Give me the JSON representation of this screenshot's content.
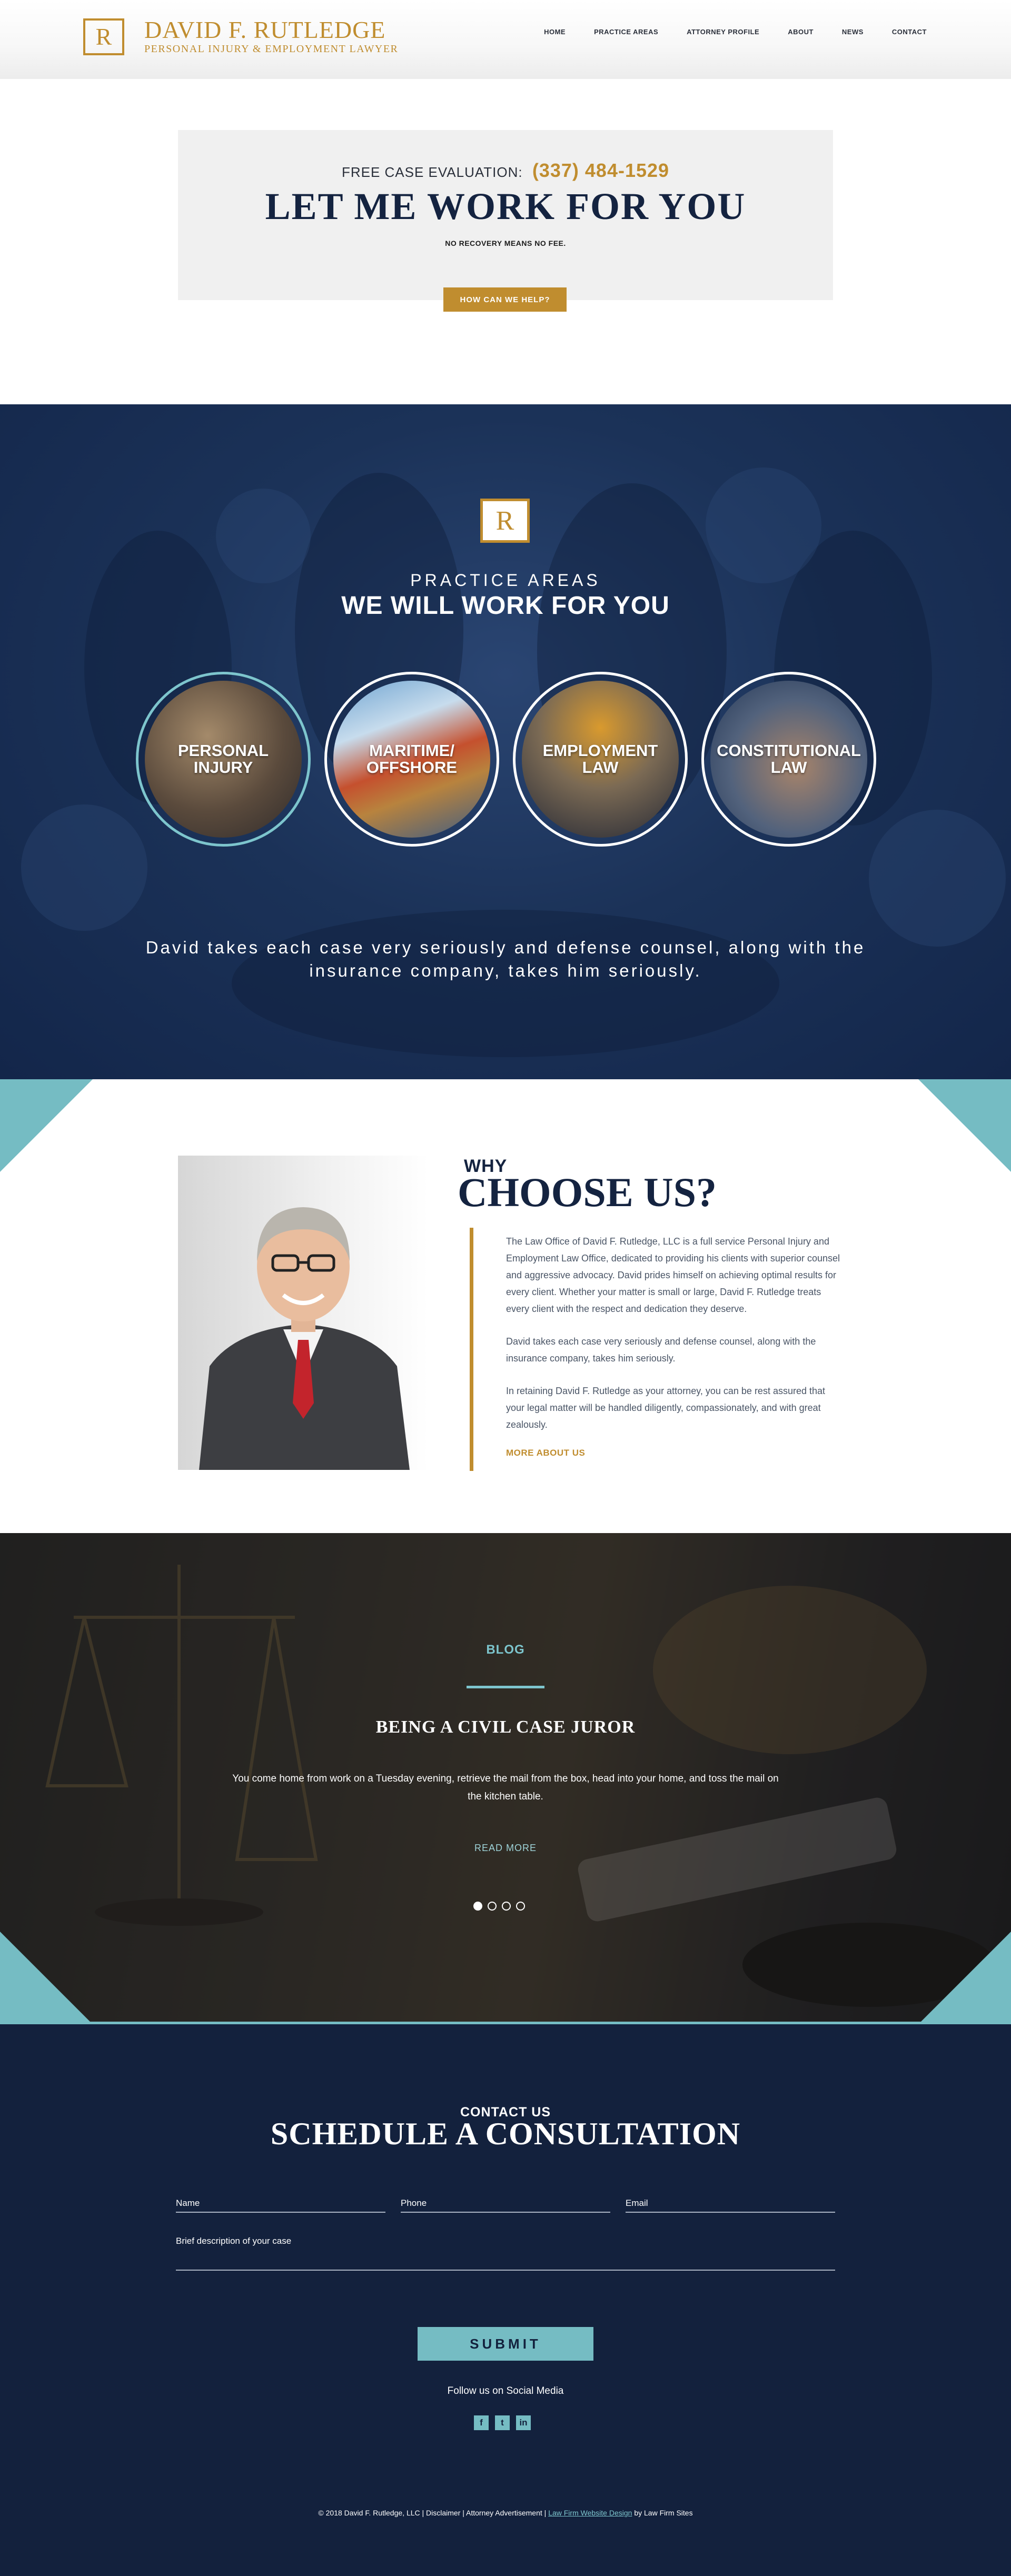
{
  "header": {
    "logo_letter": "R",
    "name": "DAVID F. RUTLEDGE",
    "tagline": "PERSONAL INJURY & EMPLOYMENT LAWYER",
    "nav": [
      "HOME",
      "PRACTICE AREAS",
      "ATTORNEY PROFILE",
      "ABOUT",
      "NEWS",
      "CONTACT"
    ]
  },
  "hero": {
    "eval_label": "FREE CASE EVALUATION:",
    "phone": "(337) 484-1529",
    "title": "LET ME WORK FOR YOU",
    "subtitle": "NO RECOVERY MEANS NO FEE.",
    "cta": "HOW CAN WE HELP?"
  },
  "practice": {
    "logo_letter": "R",
    "kicker": "PRACTICE AREAS",
    "title": "WE WILL WORK FOR YOU",
    "areas": [
      {
        "label": "PERSONAL INJURY",
        "active": true
      },
      {
        "label": "MARITIME/ OFFSHORE",
        "active": false
      },
      {
        "label": "EMPLOYMENT LAW",
        "active": false
      },
      {
        "label": "CONSTITUTIONAL LAW",
        "active": false
      }
    ],
    "quote": "David takes each case very seriously and defense counsel, along with the insurance company, takes him seriously."
  },
  "why": {
    "small": "WHY",
    "big": "CHOOSE US?",
    "paragraphs": [
      "The Law Office of David F. Rutledge, LLC is a full service Personal Injury and Employment Law Office, dedicated to providing his clients with superior counsel and aggressive advocacy. David prides himself on achieving optimal results for every client. Whether your matter is small or large, David F. Rutledge treats every client with the respect and dedication they deserve.",
      "David takes each case very seriously and defense counsel, along with the insurance company, takes him seriously.",
      "In retaining David F. Rutledge as your attorney, you can be rest assured that your legal matter will be handled diligently, compassionately, and with great zealously."
    ],
    "more": "MORE ABOUT US"
  },
  "blog": {
    "kicker": "BLOG",
    "title": "BEING A CIVIL CASE JUROR",
    "excerpt": "You come home from work on a Tuesday evening, retrieve the mail from the box, head into your home, and toss the mail on the kitchen table.",
    "read_more": "READ MORE",
    "slide_count": 4,
    "active_slide": 1
  },
  "contact": {
    "kicker": "CONTACT US",
    "title": "SCHEDULE A CONSULTATION",
    "fields": {
      "name": "Name",
      "phone": "Phone",
      "email": "Email",
      "description": "Brief description of your case"
    },
    "submit": "SUBMIT",
    "follow": "Follow us on Social Media",
    "socials": [
      "f",
      "t",
      "in"
    ],
    "footer_prefix": "© 2018 David F. Rutledge, LLC | Disclaimer | Attorney Advertisement |",
    "footer_link": "Law Firm Website Design",
    "footer_suffix": "by Law Firm Sites"
  },
  "colors": {
    "gold": "#c08d2f",
    "navy": "#13213d",
    "teal": "#75bcc3"
  }
}
